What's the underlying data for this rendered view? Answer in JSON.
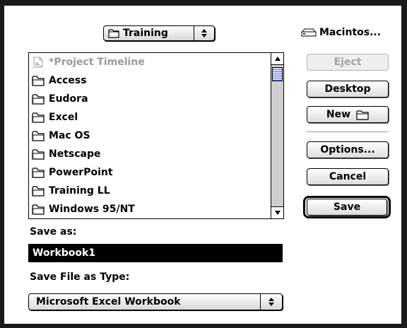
{
  "location_popup": {
    "label": "Training"
  },
  "disk": {
    "label": "Macintos..."
  },
  "file_list": {
    "items": [
      {
        "label": "*Project Timeline",
        "icon": "document-icon",
        "dimmed": true
      },
      {
        "label": "Access",
        "icon": "folder-icon"
      },
      {
        "label": "Eudora",
        "icon": "folder-icon"
      },
      {
        "label": "Excel",
        "icon": "folder-icon"
      },
      {
        "label": "Mac OS",
        "icon": "folder-icon"
      },
      {
        "label": "Netscape",
        "icon": "folder-icon"
      },
      {
        "label": "PowerPoint",
        "icon": "folder-icon"
      },
      {
        "label": "Training LL",
        "icon": "folder-icon"
      },
      {
        "label": "Windows 95/NT",
        "icon": "folder-icon"
      }
    ]
  },
  "buttons": {
    "eject": "Eject",
    "desktop": "Desktop",
    "new": "New",
    "options": "Options...",
    "cancel": "Cancel",
    "save": "Save"
  },
  "save_as": {
    "label": "Save as:",
    "value": "Workbook1"
  },
  "file_type": {
    "label": "Save File as Type:",
    "value": "Microsoft Excel Workbook"
  },
  "colors": {
    "frame": "#1a1a1a",
    "selection": "#000000",
    "scroll_thumb": "#6f7fd6"
  }
}
